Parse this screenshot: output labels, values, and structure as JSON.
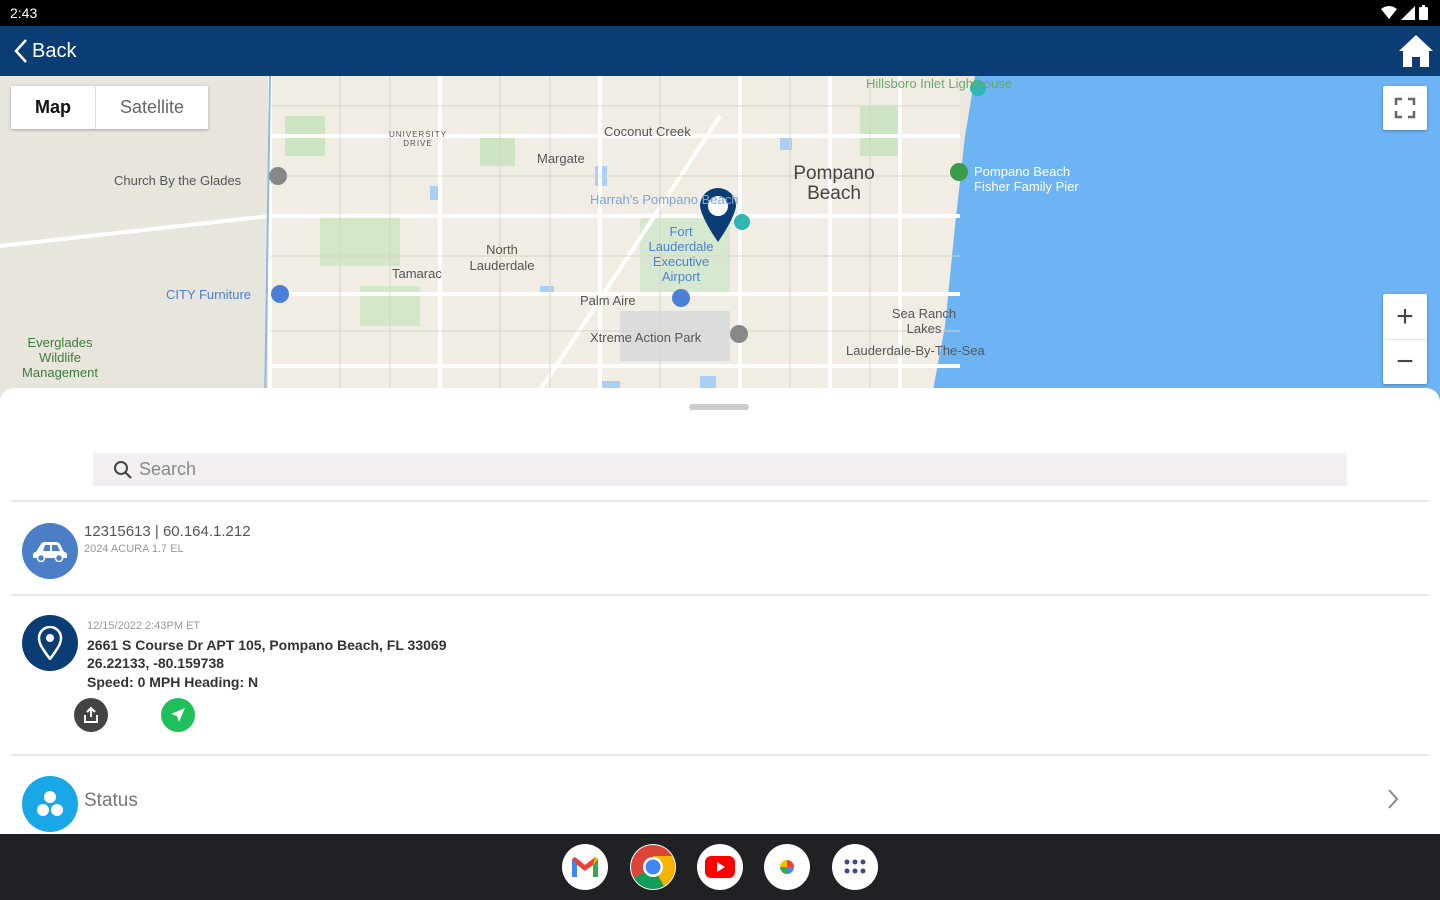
{
  "status_bar": {
    "time": "2:43"
  },
  "app_bar": {
    "back_label": "Back"
  },
  "map": {
    "type_options": [
      "Map",
      "Satellite"
    ],
    "selected_type": "Map",
    "labels": {
      "hillsboro": "Hillsboro Inlet Lighthouse",
      "coconut_creek": "Coconut Creek",
      "margate": "Margate",
      "pompano": "Pompano Beach",
      "pier": "Pompano Beach Fisher Family Pier",
      "church": "Church By the Glades",
      "harrahs": "Harrah's Pompano Beach",
      "north_lauderdale": "North Lauderdale",
      "tamarac": "Tamarac",
      "airport": "Fort Lauderdale Executive Airport",
      "city_furniture": "CITY Furniture",
      "palm_aire": "Palm Aire",
      "sea_ranch": "Sea Ranch Lakes",
      "everglades": "Everglades Wildlife Management",
      "xtreme": "Xtreme Action Park",
      "lbts": "Lauderdale-By-The-Sea",
      "university": "UNIVERSITY DRIVE"
    },
    "zoom_in": "+",
    "zoom_out": "−"
  },
  "search": {
    "placeholder": "Search",
    "value": ""
  },
  "vehicle": {
    "title": "12315613 | 60.164.1.212",
    "subtitle": "2024 ACURA 1.7 EL"
  },
  "location": {
    "timestamp": "12/15/2022 2:43PM ET",
    "address": "2661 S Course Dr APT 105, Pompano Beach, FL 33069",
    "coordinates": "26.22133, -80.159738",
    "speed_heading": "Speed: 0 MPH  Heading: N"
  },
  "status": {
    "label": "Status"
  },
  "colors": {
    "app_bar": "#0b3d75",
    "vehicle_avatar": "#4a7fc8",
    "location_avatar": "#0b3d75",
    "status_avatar": "#1aa7e8",
    "share_button": "#444444",
    "navigate_button": "#1fbf5a",
    "water": "#6db4f5"
  },
  "dock": [
    "gmail-icon",
    "chrome-icon",
    "youtube-icon",
    "photos-icon",
    "app-drawer-icon"
  ]
}
